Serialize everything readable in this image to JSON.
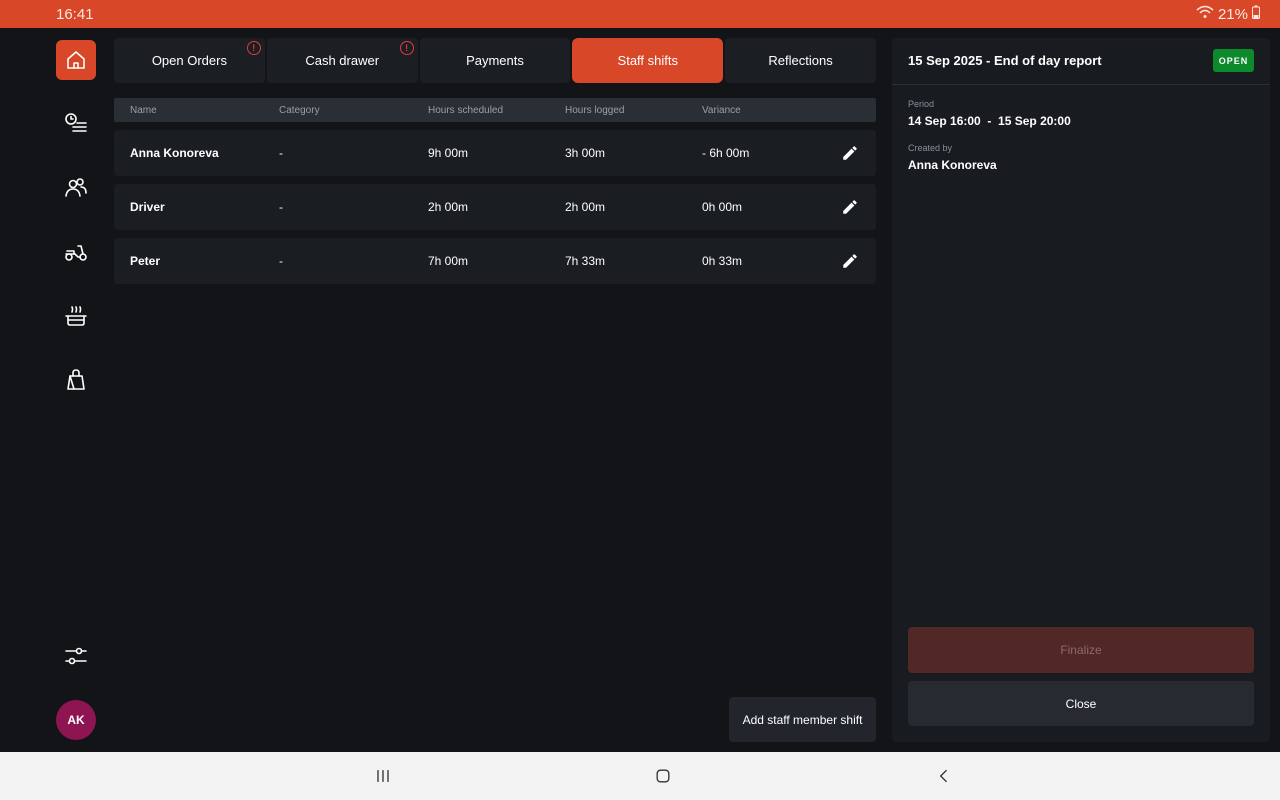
{
  "status_bar": {
    "time": "16:41",
    "battery": "21%"
  },
  "sidebar": {
    "items": [
      "home-icon",
      "history-list-icon",
      "customers-icon",
      "delivery-scooter-icon",
      "kitchen-pot-icon",
      "shopping-bag-icon"
    ],
    "settings_icon": "sliders-icon",
    "avatar_initials": "AK"
  },
  "tabs": [
    {
      "label": "Open Orders",
      "alert": true
    },
    {
      "label": "Cash drawer",
      "alert": true
    },
    {
      "label": "Payments",
      "alert": false
    },
    {
      "label": "Staff shifts",
      "alert": false,
      "active": true
    },
    {
      "label": "Reflections",
      "alert": false
    }
  ],
  "alert_symbol": "!",
  "table": {
    "headers": [
      "Name",
      "Category",
      "Hours scheduled",
      "Hours logged",
      "Variance"
    ],
    "rows": [
      {
        "name": "Anna Konoreva",
        "category": "-",
        "scheduled": "9h 00m",
        "logged": "3h 00m",
        "variance": "- 6h 00m"
      },
      {
        "name": "Driver",
        "category": "-",
        "scheduled": "2h 00m",
        "logged": "2h 00m",
        "variance": "0h 00m"
      },
      {
        "name": "Peter",
        "category": "-",
        "scheduled": "7h 00m",
        "logged": "7h 33m",
        "variance": "0h 33m"
      }
    ]
  },
  "add_button": "Add staff member shift",
  "report": {
    "title": "15 Sep 2025 - End of day report",
    "status": "OPEN",
    "period_label": "Period",
    "period_value": "14 Sep 16:00  -  15 Sep 20:00",
    "created_label": "Created by",
    "created_value": "Anna Konoreva",
    "finalize_label": "Finalize",
    "close_label": "Close"
  },
  "colors": {
    "accent": "#d84727",
    "status_open": "#0c8a2c",
    "avatar": "#8e1551"
  }
}
